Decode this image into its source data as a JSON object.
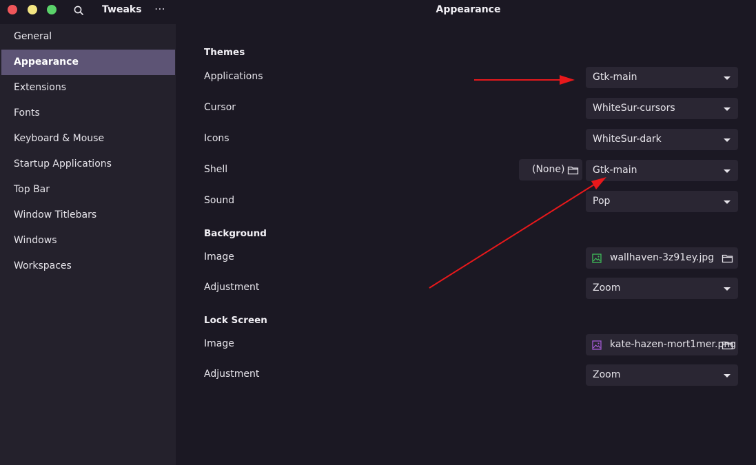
{
  "header": {
    "app_title": "Tweaks",
    "page_title": "Appearance",
    "menu_label": "⋯"
  },
  "sidebar": {
    "items": [
      {
        "label": "General"
      },
      {
        "label": "Appearance",
        "active": true
      },
      {
        "label": "Extensions"
      },
      {
        "label": "Fonts"
      },
      {
        "label": "Keyboard & Mouse"
      },
      {
        "label": "Startup Applications"
      },
      {
        "label": "Top Bar"
      },
      {
        "label": "Window Titlebars"
      },
      {
        "label": "Windows"
      },
      {
        "label": "Workspaces"
      }
    ]
  },
  "themes": {
    "title": "Themes",
    "applications": {
      "label": "Applications",
      "value": "Gtk-main"
    },
    "cursor": {
      "label": "Cursor",
      "value": "WhiteSur-cursors"
    },
    "icons": {
      "label": "Icons",
      "value": "WhiteSur-dark"
    },
    "shell": {
      "label": "Shell",
      "value": "Gtk-main",
      "file_value": "(None)"
    },
    "sound": {
      "label": "Sound",
      "value": "Pop"
    }
  },
  "background": {
    "title": "Background",
    "image": {
      "label": "Image",
      "value": "wallhaven-3z91ey.jpg"
    },
    "adjustment": {
      "label": "Adjustment",
      "value": "Zoom"
    }
  },
  "lock_screen": {
    "title": "Lock Screen",
    "image": {
      "label": "Image",
      "value": "kate-hazen-mort1mer.png"
    },
    "adjustment": {
      "label": "Adjustment",
      "value": "Zoom"
    }
  },
  "colors": {
    "accent_active": "#5d5475",
    "annotation_arrow": "#e8181b",
    "bg_image_icon": "#3fbf5a",
    "lock_image_icon": "#a45ad6"
  }
}
